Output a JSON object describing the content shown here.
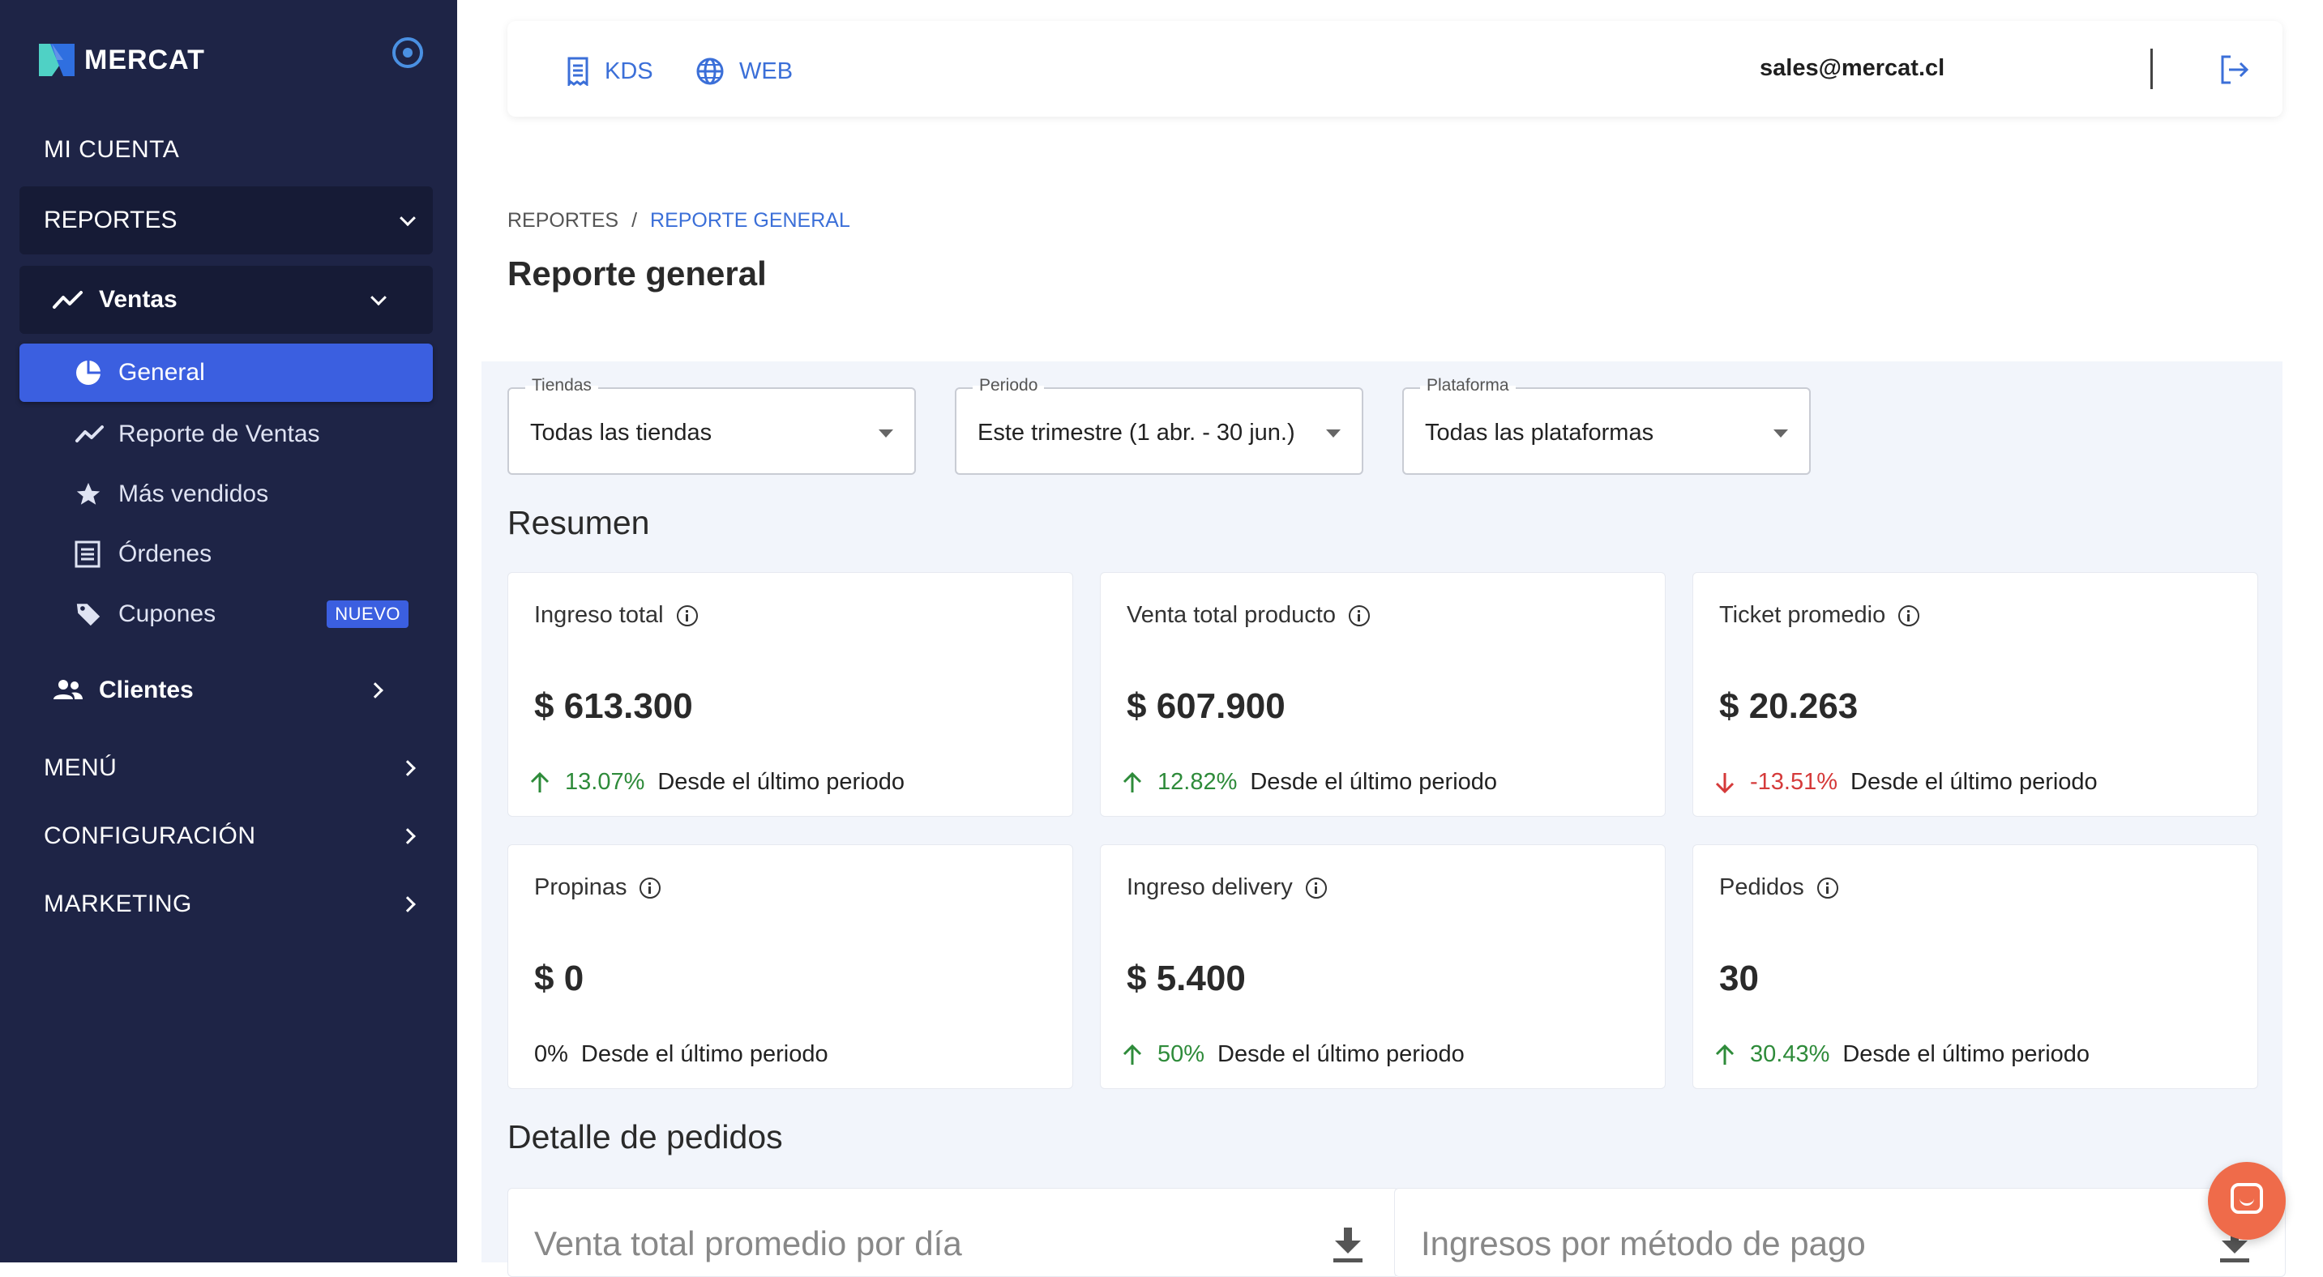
{
  "brand": {
    "name": "MERCAT"
  },
  "sidebar": {
    "mi_cuenta": "MI CUENTA",
    "reportes": "REPORTES",
    "ventas": "Ventas",
    "items": [
      {
        "label": "General",
        "icon": "pie-chart-icon"
      },
      {
        "label": "Reporte de Ventas",
        "icon": "trending-icon"
      },
      {
        "label": "Más vendidos",
        "icon": "star-icon"
      },
      {
        "label": "Órdenes",
        "icon": "list-icon"
      },
      {
        "label": "Cupones",
        "icon": "tag-icon",
        "badge": "NUEVO"
      }
    ],
    "clientes": "Clientes",
    "menu": "MENÚ",
    "configuracion": "CONFIGURACIÓN",
    "marketing": "MARKETING"
  },
  "topbar": {
    "kds": "KDS",
    "web": "WEB",
    "email": "sales@mercat.cl"
  },
  "breadcrumb": {
    "root": "REPORTES",
    "separator": "/",
    "current": "REPORTE GENERAL"
  },
  "page_title": "Reporte general",
  "filters": {
    "tiendas": {
      "label": "Tiendas",
      "value": "Todas las tiendas"
    },
    "periodo": {
      "label": "Periodo",
      "value": "Este trimestre (1 abr. - 30 jun.)"
    },
    "plataforma": {
      "label": "Plataforma",
      "value": "Todas las plataformas"
    }
  },
  "resumen": {
    "title": "Resumen",
    "cards": [
      {
        "title": "Ingreso total",
        "value": "$ 613.300",
        "pct": "13.07%",
        "trend": "up",
        "since": "Desde el último periodo"
      },
      {
        "title": "Venta total producto",
        "value": "$ 607.900",
        "pct": "12.82%",
        "trend": "up",
        "since": "Desde el último periodo"
      },
      {
        "title": "Ticket promedio",
        "value": "$ 20.263",
        "pct": "-13.51%",
        "trend": "down",
        "since": "Desde el último periodo"
      },
      {
        "title": "Propinas",
        "value": "$ 0",
        "pct": "0%",
        "trend": "flat",
        "since": "Desde el último periodo"
      },
      {
        "title": "Ingreso delivery",
        "value": "$ 5.400",
        "pct": "50%",
        "trend": "up",
        "since": "Desde el último periodo"
      },
      {
        "title": "Pedidos",
        "value": "30",
        "pct": "30.43%",
        "trend": "up",
        "since": "Desde el último periodo"
      }
    ]
  },
  "detalle": {
    "title": "Detalle de pedidos",
    "charts": [
      {
        "title": "Venta total promedio por día"
      },
      {
        "title": "Ingresos por método de pago"
      }
    ]
  },
  "colors": {
    "sidebar_bg": "#1e2446",
    "active_item": "#3b5fe0",
    "link_blue": "#3b6fd8",
    "positive": "#2e8b3a",
    "negative": "#d53a3a",
    "chat_button": "#ef6b4a"
  }
}
